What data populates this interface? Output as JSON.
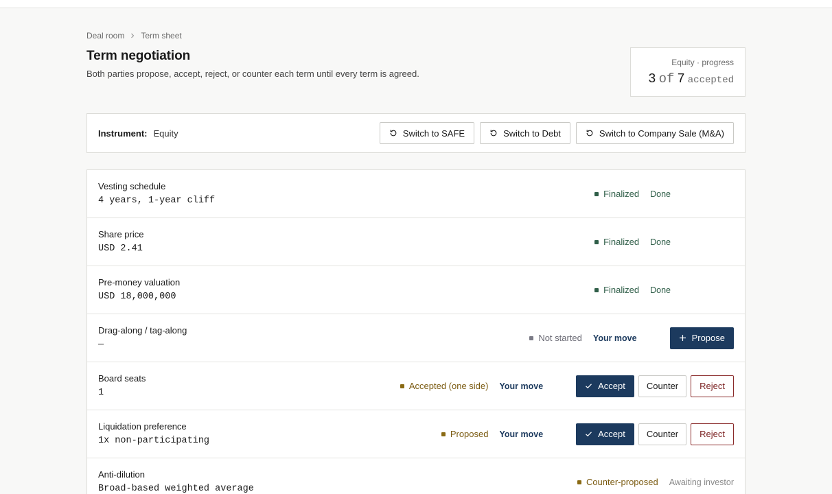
{
  "breadcrumb": [
    "Deal room",
    "Term sheet"
  ],
  "page": {
    "title": "Term negotiation",
    "subtitle": "Both parties propose, accept, reject, or counter each term until every term is agreed."
  },
  "progress": {
    "label": "Equity · progress",
    "accepted": "3",
    "of": "of",
    "total": "7",
    "suffix": "accepted"
  },
  "instrument": {
    "label": "Instrument:",
    "value": "Equity",
    "switch_safe": "Switch to SAFE",
    "switch_debt": "Switch to Debt",
    "switch_ma": "Switch to Company Sale (M&A)"
  },
  "colors": {
    "finalized": "#2f5e48",
    "not_started": "#6b6b75",
    "accepted_one_side": "#7a5a10",
    "proposed": "#7a5a10",
    "counter_proposed": "#7a5a10",
    "primary": "#1c3a5e",
    "reject": "#8a2a2a"
  },
  "terms": [
    {
      "name": "Vesting schedule",
      "value": "4 years, 1-year cliff",
      "status": "Finalized",
      "turn": "Done"
    },
    {
      "name": "Share price",
      "value": "USD 2.41",
      "status": "Finalized",
      "turn": "Done"
    },
    {
      "name": "Pre-money valuation",
      "value": "USD 18,000,000",
      "status": "Finalized",
      "turn": "Done"
    },
    {
      "name": "Drag-along / tag-along",
      "value": "—",
      "status": "Not started",
      "turn": "Your move",
      "action": "Propose"
    },
    {
      "name": "Board seats",
      "value": "1",
      "status": "Accepted (one side)",
      "turn": "Your move",
      "accept": "Accept",
      "counter": "Counter",
      "reject": "Reject"
    },
    {
      "name": "Liquidation preference",
      "value": "1x non-participating",
      "status": "Proposed",
      "turn": "Your move",
      "accept": "Accept",
      "counter": "Counter",
      "reject": "Reject"
    },
    {
      "name": "Anti-dilution",
      "value": "Broad-based weighted average",
      "status": "Counter-proposed",
      "turn": "Awaiting investor"
    }
  ]
}
